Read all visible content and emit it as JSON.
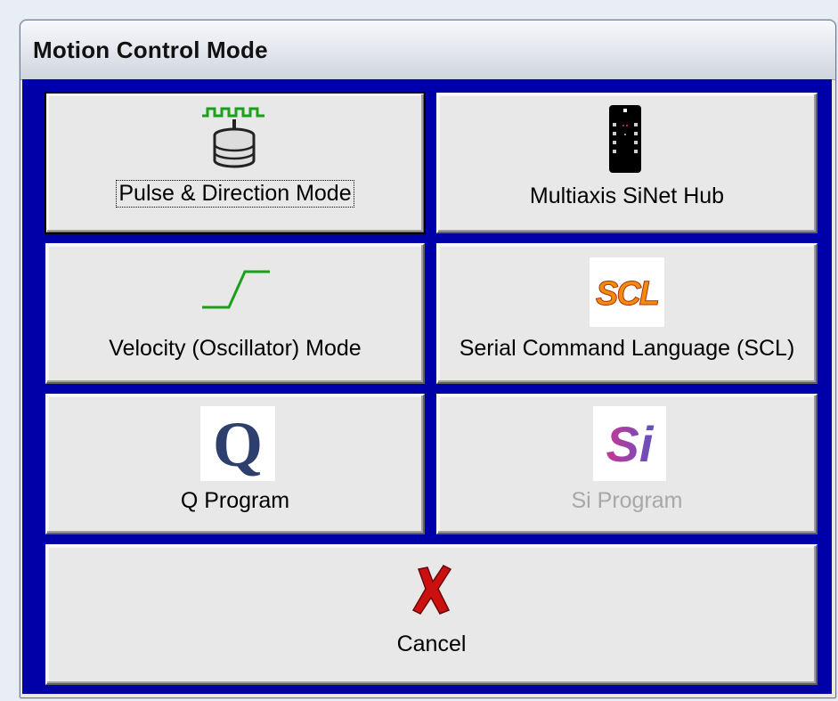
{
  "window": {
    "title": "Motion Control Mode"
  },
  "buttons": {
    "pulse_direction": {
      "label": "Pulse & Direction Mode",
      "icon": "stepper-motor-pulse-icon"
    },
    "multiaxis_hub": {
      "label": "Multiaxis SiNet Hub",
      "icon": "hub-chip-icon"
    },
    "velocity": {
      "label": "Velocity (Oscillator) Mode",
      "icon": "velocity-ramp-icon"
    },
    "scl": {
      "label": "Serial Command Language (SCL)",
      "icon": "scl-logo-icon",
      "logo_text": "SCL"
    },
    "q_program": {
      "label": "Q Program",
      "icon": "q-logo-icon",
      "logo_text": "Q"
    },
    "si_program": {
      "label": "Si Program",
      "icon": "si-logo-icon",
      "logo_text": "Si",
      "disabled": true
    },
    "cancel": {
      "label": "Cancel",
      "icon": "cancel-x-icon"
    }
  },
  "colors": {
    "background_blue": "#0000a8",
    "button_face": "#e8e8e8",
    "pulse_green": "#1aa01a",
    "cancel_red": "#cc1010",
    "disabled_text": "#a8a8a8"
  }
}
